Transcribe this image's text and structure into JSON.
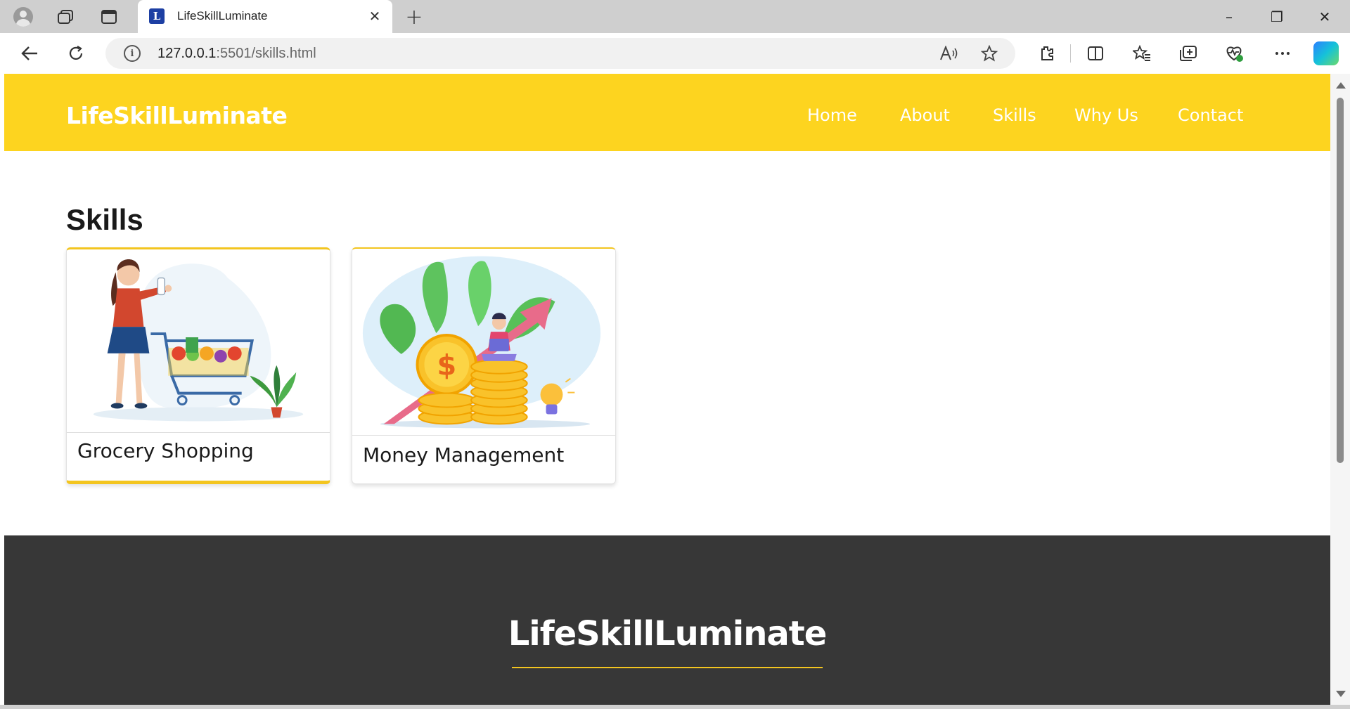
{
  "browser": {
    "tab_title": "LifeSkillLuminate",
    "tab_favicon_letter": "L",
    "url_host": "127.0.0.1",
    "url_rest": ":5501/skills.html",
    "window_controls": {
      "minimize": "–",
      "restore": "❐",
      "close": "✕"
    },
    "icons": [
      "profile-icon",
      "workspaces-icon",
      "vertical-tabs-icon",
      "back-icon",
      "refresh-icon",
      "info-icon",
      "read-aloud-icon",
      "favorite-star-icon",
      "extensions-icon",
      "split-screen-icon",
      "favorites-icon",
      "collections-icon",
      "browser-essentials-icon",
      "more-icon",
      "copilot-icon"
    ]
  },
  "site": {
    "brand": "LifeSkillLuminate",
    "nav": [
      "Home",
      "About",
      "Skills",
      "Why Us",
      "Contact"
    ],
    "section_title": "Skills",
    "cards": [
      {
        "label": "Grocery Shopping",
        "image": "woman-with-shopping-cart-illustration"
      },
      {
        "label": "Money Management",
        "image": "coins-growth-chart-illustration"
      }
    ],
    "footer_brand": "LifeSkillLuminate"
  },
  "colors": {
    "header_yellow": "#fdd41f",
    "accent_yellow": "#f3c51f",
    "footer_dark": "#373737"
  }
}
